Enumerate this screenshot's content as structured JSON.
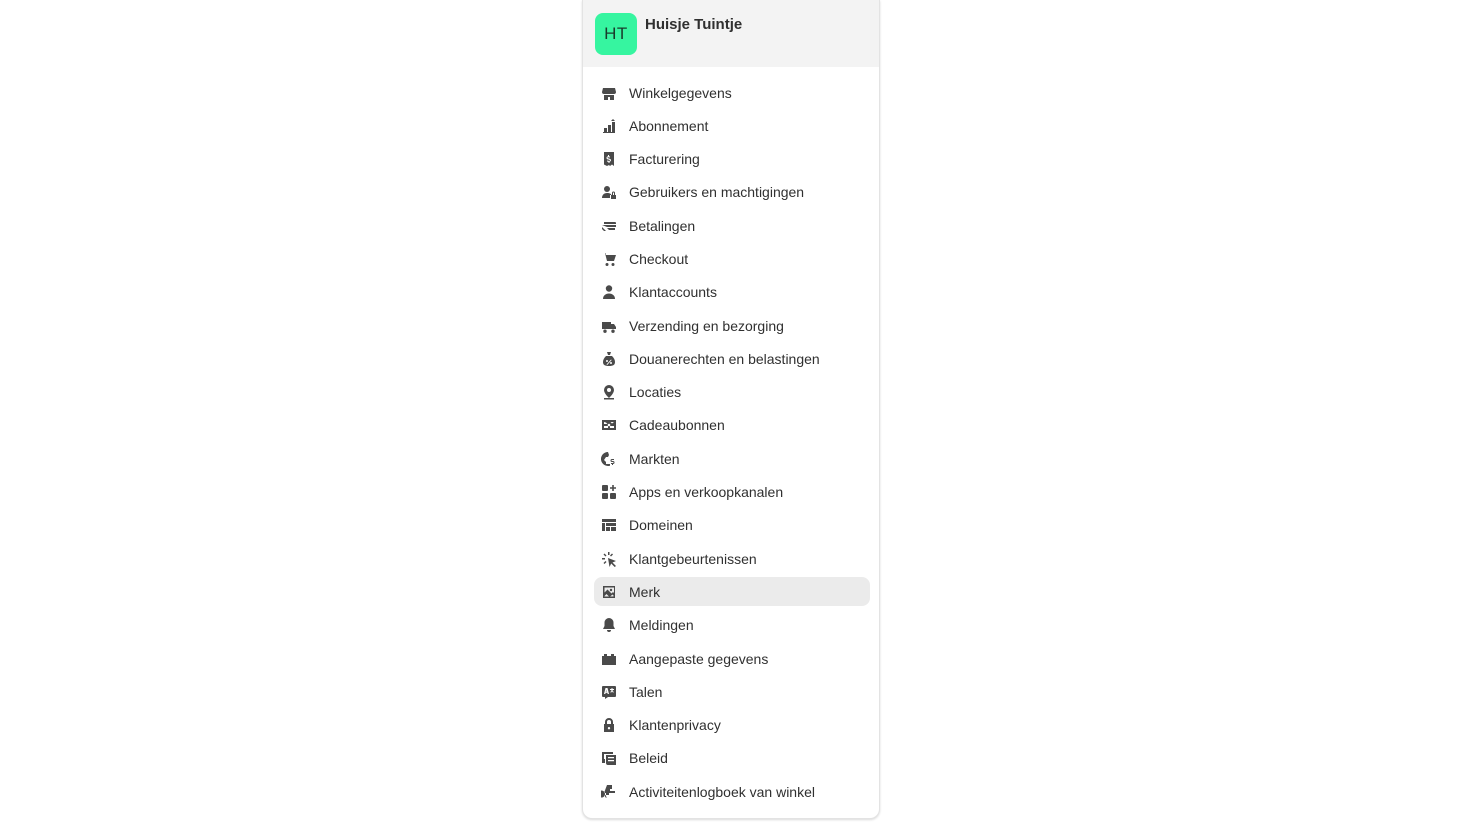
{
  "store": {
    "initials": "HT",
    "name": "Huisje Tuintje",
    "avatar_color": "#36f5a0"
  },
  "nav": {
    "active_index": 15,
    "items": [
      {
        "label": "Winkelgegevens",
        "icon": "store-icon"
      },
      {
        "label": "Abonnement",
        "icon": "plan-icon"
      },
      {
        "label": "Facturering",
        "icon": "billing-icon"
      },
      {
        "label": "Gebruikers en machtigingen",
        "icon": "users-icon"
      },
      {
        "label": "Betalingen",
        "icon": "payments-icon"
      },
      {
        "label": "Checkout",
        "icon": "cart-icon"
      },
      {
        "label": "Klantaccounts",
        "icon": "person-icon"
      },
      {
        "label": "Verzending en bezorging",
        "icon": "truck-icon"
      },
      {
        "label": "Douanerechten en belastingen",
        "icon": "tax-icon"
      },
      {
        "label": "Locaties",
        "icon": "location-icon"
      },
      {
        "label": "Cadeaubonnen",
        "icon": "gift-card-icon"
      },
      {
        "label": "Markten",
        "icon": "globe-icon"
      },
      {
        "label": "Apps en verkoopkanalen",
        "icon": "apps-icon"
      },
      {
        "label": "Domeinen",
        "icon": "domain-icon"
      },
      {
        "label": "Klantgebeurtenissen",
        "icon": "cursor-click-icon"
      },
      {
        "label": "Merk",
        "icon": "brand-icon"
      },
      {
        "label": "Meldingen",
        "icon": "bell-icon"
      },
      {
        "label": "Aangepaste gegevens",
        "icon": "metafields-icon"
      },
      {
        "label": "Talen",
        "icon": "language-icon"
      },
      {
        "label": "Klantenprivacy",
        "icon": "lock-icon"
      },
      {
        "label": "Beleid",
        "icon": "policy-icon"
      },
      {
        "label": "Activiteitenlogboek van winkel",
        "icon": "activity-log-icon"
      }
    ]
  }
}
